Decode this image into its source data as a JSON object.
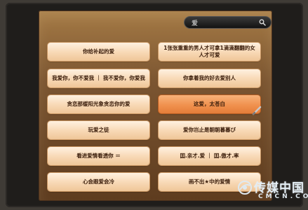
{
  "search": {
    "value": "爱",
    "icon": "search-icon"
  },
  "buttons": [
    {
      "label": "你给补起的爱"
    },
    {
      "label": "1张张重重的男人才可拿1滴滴翻翻的女人才可爱"
    },
    {
      "label": "我爱你，你不爱我 ｜ 我不爱你，你爱我"
    },
    {
      "label": "你拿着我的好去爱别人"
    },
    {
      "label": "贪恋那缓阳光象贪恋你的爱"
    },
    {
      "label": "这爱，太苍白",
      "active": true
    },
    {
      "label": "玩爱之徒"
    },
    {
      "label": "爱你岂止是朝朝暮暮び"
    },
    {
      "label": "看进爱情看透你 ＝"
    },
    {
      "label": "囯.亲才.爱 ｜ 囯.傲才.率"
    },
    {
      "label": "心会跟爱会冷"
    },
    {
      "label": "画不出★中的爱情"
    }
  ],
  "watermark": {
    "cn": "传媒中国",
    "en": "CMCN.COM"
  },
  "colors": {
    "panel": "#7b5531",
    "button": "#f8d9b6",
    "active_button": "#f0914e",
    "text": "#3b1e0c"
  }
}
